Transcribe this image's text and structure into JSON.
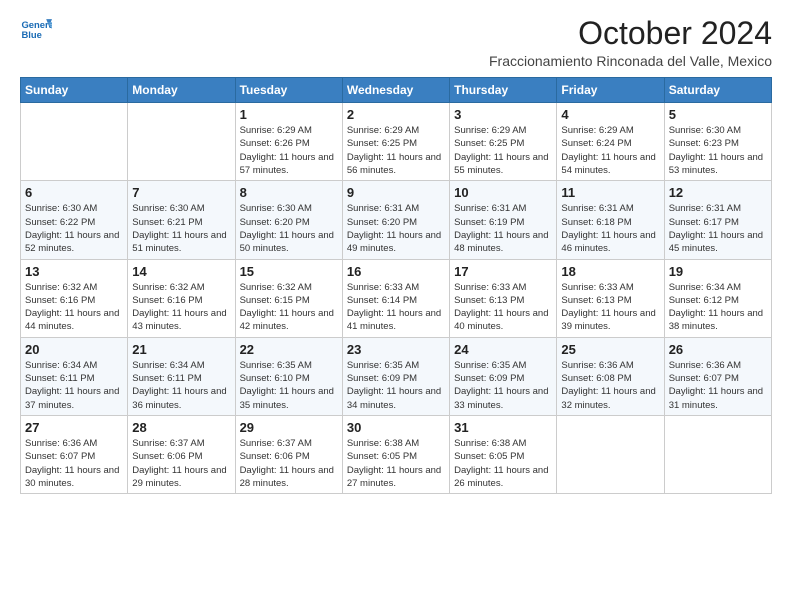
{
  "logo": {
    "line1": "General",
    "line2": "Blue"
  },
  "title": "October 2024",
  "subtitle": "Fraccionamiento Rinconada del Valle, Mexico",
  "days_of_week": [
    "Sunday",
    "Monday",
    "Tuesday",
    "Wednesday",
    "Thursday",
    "Friday",
    "Saturday"
  ],
  "weeks": [
    [
      {
        "day": "",
        "info": ""
      },
      {
        "day": "",
        "info": ""
      },
      {
        "day": "1",
        "sunrise": "6:29 AM",
        "sunset": "6:26 PM",
        "daylight": "11 hours and 57 minutes."
      },
      {
        "day": "2",
        "sunrise": "6:29 AM",
        "sunset": "6:25 PM",
        "daylight": "11 hours and 56 minutes."
      },
      {
        "day": "3",
        "sunrise": "6:29 AM",
        "sunset": "6:25 PM",
        "daylight": "11 hours and 55 minutes."
      },
      {
        "day": "4",
        "sunrise": "6:29 AM",
        "sunset": "6:24 PM",
        "daylight": "11 hours and 54 minutes."
      },
      {
        "day": "5",
        "sunrise": "6:30 AM",
        "sunset": "6:23 PM",
        "daylight": "11 hours and 53 minutes."
      }
    ],
    [
      {
        "day": "6",
        "sunrise": "6:30 AM",
        "sunset": "6:22 PM",
        "daylight": "11 hours and 52 minutes."
      },
      {
        "day": "7",
        "sunrise": "6:30 AM",
        "sunset": "6:21 PM",
        "daylight": "11 hours and 51 minutes."
      },
      {
        "day": "8",
        "sunrise": "6:30 AM",
        "sunset": "6:20 PM",
        "daylight": "11 hours and 50 minutes."
      },
      {
        "day": "9",
        "sunrise": "6:31 AM",
        "sunset": "6:20 PM",
        "daylight": "11 hours and 49 minutes."
      },
      {
        "day": "10",
        "sunrise": "6:31 AM",
        "sunset": "6:19 PM",
        "daylight": "11 hours and 48 minutes."
      },
      {
        "day": "11",
        "sunrise": "6:31 AM",
        "sunset": "6:18 PM",
        "daylight": "11 hours and 46 minutes."
      },
      {
        "day": "12",
        "sunrise": "6:31 AM",
        "sunset": "6:17 PM",
        "daylight": "11 hours and 45 minutes."
      }
    ],
    [
      {
        "day": "13",
        "sunrise": "6:32 AM",
        "sunset": "6:16 PM",
        "daylight": "11 hours and 44 minutes."
      },
      {
        "day": "14",
        "sunrise": "6:32 AM",
        "sunset": "6:16 PM",
        "daylight": "11 hours and 43 minutes."
      },
      {
        "day": "15",
        "sunrise": "6:32 AM",
        "sunset": "6:15 PM",
        "daylight": "11 hours and 42 minutes."
      },
      {
        "day": "16",
        "sunrise": "6:33 AM",
        "sunset": "6:14 PM",
        "daylight": "11 hours and 41 minutes."
      },
      {
        "day": "17",
        "sunrise": "6:33 AM",
        "sunset": "6:13 PM",
        "daylight": "11 hours and 40 minutes."
      },
      {
        "day": "18",
        "sunrise": "6:33 AM",
        "sunset": "6:13 PM",
        "daylight": "11 hours and 39 minutes."
      },
      {
        "day": "19",
        "sunrise": "6:34 AM",
        "sunset": "6:12 PM",
        "daylight": "11 hours and 38 minutes."
      }
    ],
    [
      {
        "day": "20",
        "sunrise": "6:34 AM",
        "sunset": "6:11 PM",
        "daylight": "11 hours and 37 minutes."
      },
      {
        "day": "21",
        "sunrise": "6:34 AM",
        "sunset": "6:11 PM",
        "daylight": "11 hours and 36 minutes."
      },
      {
        "day": "22",
        "sunrise": "6:35 AM",
        "sunset": "6:10 PM",
        "daylight": "11 hours and 35 minutes."
      },
      {
        "day": "23",
        "sunrise": "6:35 AM",
        "sunset": "6:09 PM",
        "daylight": "11 hours and 34 minutes."
      },
      {
        "day": "24",
        "sunrise": "6:35 AM",
        "sunset": "6:09 PM",
        "daylight": "11 hours and 33 minutes."
      },
      {
        "day": "25",
        "sunrise": "6:36 AM",
        "sunset": "6:08 PM",
        "daylight": "11 hours and 32 minutes."
      },
      {
        "day": "26",
        "sunrise": "6:36 AM",
        "sunset": "6:07 PM",
        "daylight": "11 hours and 31 minutes."
      }
    ],
    [
      {
        "day": "27",
        "sunrise": "6:36 AM",
        "sunset": "6:07 PM",
        "daylight": "11 hours and 30 minutes."
      },
      {
        "day": "28",
        "sunrise": "6:37 AM",
        "sunset": "6:06 PM",
        "daylight": "11 hours and 29 minutes."
      },
      {
        "day": "29",
        "sunrise": "6:37 AM",
        "sunset": "6:06 PM",
        "daylight": "11 hours and 28 minutes."
      },
      {
        "day": "30",
        "sunrise": "6:38 AM",
        "sunset": "6:05 PM",
        "daylight": "11 hours and 27 minutes."
      },
      {
        "day": "31",
        "sunrise": "6:38 AM",
        "sunset": "6:05 PM",
        "daylight": "11 hours and 26 minutes."
      },
      {
        "day": "",
        "info": ""
      },
      {
        "day": "",
        "info": ""
      }
    ]
  ],
  "cell_labels": {
    "sunrise": "Sunrise: ",
    "sunset": "Sunset: ",
    "daylight": "Daylight: "
  }
}
